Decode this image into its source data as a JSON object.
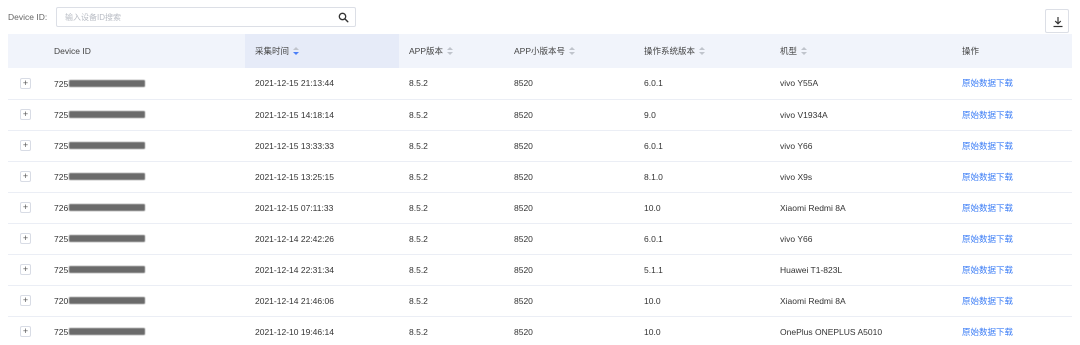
{
  "search": {
    "label": "Device ID:",
    "placeholder": "输入设备ID搜索",
    "value": ""
  },
  "icons": {
    "search": "search-icon",
    "download": "download-icon",
    "expand": "plus-icon",
    "sort": "sort-caret-icon"
  },
  "colors": {
    "header_bg": "#f1f4fb",
    "sorted_header_bg": "#e6ebf8",
    "link": "#3a7cf6",
    "active_sort": "#4a7ff7"
  },
  "table": {
    "columns": [
      {
        "key": "device_id",
        "label": "Device ID",
        "sortable": false
      },
      {
        "key": "time",
        "label": "采集时间",
        "sortable": true,
        "sort": "descending"
      },
      {
        "key": "app_version",
        "label": "APP版本",
        "sortable": true
      },
      {
        "key": "app_build",
        "label": "APP小版本号",
        "sortable": true
      },
      {
        "key": "os_version",
        "label": "操作系统版本",
        "sortable": true
      },
      {
        "key": "model",
        "label": "机型",
        "sortable": true
      },
      {
        "key": "action",
        "label": "操作",
        "sortable": false
      }
    ],
    "rows": [
      {
        "expand": "+",
        "device_id_prefix": "725",
        "time": "2021-12-15 21:13:44",
        "app_version": "8.5.2",
        "app_build": "8520",
        "os_version": "6.0.1",
        "model": "vivo Y55A",
        "action": "原始数据下载"
      },
      {
        "expand": "+",
        "device_id_prefix": "725",
        "time": "2021-12-15 14:18:14",
        "app_version": "8.5.2",
        "app_build": "8520",
        "os_version": "9.0",
        "model": "vivo V1934A",
        "action": "原始数据下载"
      },
      {
        "expand": "+",
        "device_id_prefix": "725",
        "time": "2021-12-15 13:33:33",
        "app_version": "8.5.2",
        "app_build": "8520",
        "os_version": "6.0.1",
        "model": "vivo Y66",
        "action": "原始数据下载"
      },
      {
        "expand": "+",
        "device_id_prefix": "725",
        "time": "2021-12-15 13:25:15",
        "app_version": "8.5.2",
        "app_build": "8520",
        "os_version": "8.1.0",
        "model": "vivo X9s",
        "action": "原始数据下载"
      },
      {
        "expand": "+",
        "device_id_prefix": "726",
        "time": "2021-12-15 07:11:33",
        "app_version": "8.5.2",
        "app_build": "8520",
        "os_version": "10.0",
        "model": "Xiaomi Redmi 8A",
        "action": "原始数据下载"
      },
      {
        "expand": "+",
        "device_id_prefix": "725",
        "time": "2021-12-14 22:42:26",
        "app_version": "8.5.2",
        "app_build": "8520",
        "os_version": "6.0.1",
        "model": "vivo Y66",
        "action": "原始数据下载"
      },
      {
        "expand": "+",
        "device_id_prefix": "725",
        "time": "2021-12-14 22:31:34",
        "app_version": "8.5.2",
        "app_build": "8520",
        "os_version": "5.1.1",
        "model": "Huawei T1-823L",
        "action": "原始数据下载"
      },
      {
        "expand": "+",
        "device_id_prefix": "720",
        "time": "2021-12-14 21:46:06",
        "app_version": "8.5.2",
        "app_build": "8520",
        "os_version": "10.0",
        "model": "Xiaomi Redmi 8A",
        "action": "原始数据下载"
      },
      {
        "expand": "+",
        "device_id_prefix": "725",
        "time": "2021-12-10 19:46:14",
        "app_version": "8.5.2",
        "app_build": "8520",
        "os_version": "10.0",
        "model": "OnePlus ONEPLUS A5010",
        "action": "原始数据下载"
      }
    ]
  }
}
